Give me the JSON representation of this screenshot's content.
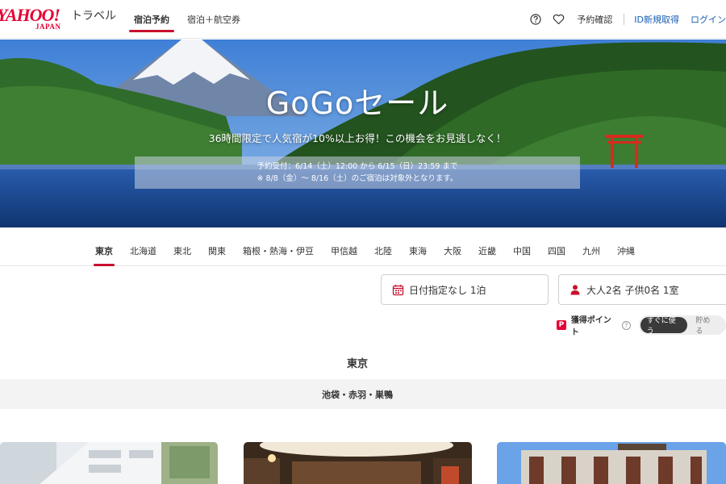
{
  "header": {
    "logo_yahoo": "YAHOO!",
    "logo_japan": "JAPAN",
    "logo_service": "トラベル",
    "tabs": [
      {
        "label": "宿泊予約",
        "active": true
      },
      {
        "label": "宿泊＋航空券",
        "active": false
      }
    ],
    "reservation_label": "予約確認",
    "register_label": "ID新規取得",
    "login_label": "ログイン",
    "icons": [
      "help-icon",
      "heart-icon"
    ]
  },
  "hero": {
    "title": "GoGoセール",
    "subtitle": "36時間限定で人気宿が10%以上お得！この機会をお見逃しなく！",
    "notice_line1": "予約受付：6/14（土）12:00 から 6/15（日）23:59 まで",
    "notice_line2": "※ 8/8（金）～ 8/16（土）のご宿泊は対象外となります。"
  },
  "regions": [
    {
      "label": "東京",
      "active": true
    },
    {
      "label": "北海道"
    },
    {
      "label": "東北"
    },
    {
      "label": "関東"
    },
    {
      "label": "箱根・熱海・伊豆"
    },
    {
      "label": "甲信越"
    },
    {
      "label": "北陸"
    },
    {
      "label": "東海"
    },
    {
      "label": "大阪"
    },
    {
      "label": "近畿"
    },
    {
      "label": "中国"
    },
    {
      "label": "四国"
    },
    {
      "label": "九州"
    },
    {
      "label": "沖縄"
    }
  ],
  "search": {
    "date_value": "日付指定なし 1泊",
    "guest_value": "大人2名 子供0名 1室"
  },
  "points": {
    "label": "獲得ポイント",
    "help": "?",
    "use_now": "すぐに使う",
    "save": "貯める",
    "selected": "すぐに使う"
  },
  "section": {
    "title": "東京",
    "area": "池袋・赤羽・巣鴨"
  },
  "colors": {
    "accent": "#c8102e",
    "brand": "#e60033",
    "link": "#1a5fb4"
  }
}
